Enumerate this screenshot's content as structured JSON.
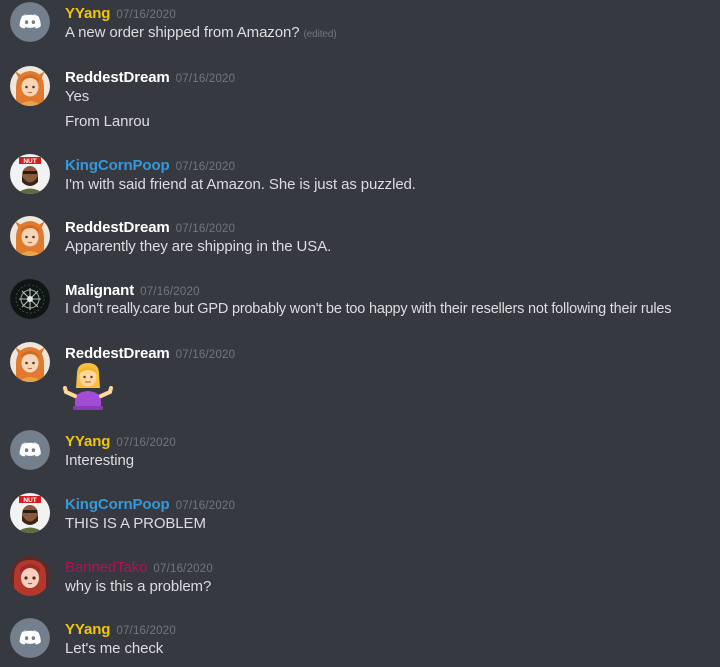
{
  "colors": {
    "background": "#36393f",
    "message_text": "#dcddde",
    "timestamp": "#72767d",
    "role_gold": "#f1c40f",
    "role_blue": "#3498db",
    "role_white": "#ffffff",
    "role_red": "#ad1457"
  },
  "messages": [
    {
      "username": "YYang",
      "timestamp": "07/16/2020",
      "avatar_icon": "discord-default-avatar-icon",
      "lines": [
        "A new order shipped from Amazon?"
      ],
      "edited_label": "(edited)"
    },
    {
      "username": "ReddestDream",
      "timestamp": "07/16/2020",
      "avatar_icon": "anime-girl-avatar-icon",
      "lines": [
        "Yes",
        "From Lanrou"
      ]
    },
    {
      "username": "KingCornPoop",
      "timestamp": "07/16/2020",
      "avatar_icon": "nut-bearded-man-avatar-icon",
      "lines": [
        "I'm with said friend at Amazon.  She is just as puzzled."
      ]
    },
    {
      "username": "ReddestDream",
      "timestamp": "07/16/2020",
      "avatar_icon": "anime-girl-avatar-icon",
      "lines": [
        "Apparently they are shipping in the USA."
      ]
    },
    {
      "username": "Malignant",
      "timestamp": "07/16/2020",
      "avatar_icon": "dark-emblem-avatar-icon",
      "lines": [
        "I don't really.care but GPD probably won't be too happy with their resellers not following their rules"
      ]
    },
    {
      "username": "ReddestDream",
      "timestamp": "07/16/2020",
      "avatar_icon": "anime-girl-avatar-icon",
      "lines": [],
      "emoji": "woman-shrugging-emoji-icon"
    },
    {
      "username": "YYang",
      "timestamp": "07/16/2020",
      "avatar_icon": "discord-default-avatar-icon",
      "lines": [
        "Interesting"
      ]
    },
    {
      "username": "KingCornPoop",
      "timestamp": "07/16/2020",
      "avatar_icon": "nut-bearded-man-avatar-icon",
      "lines": [
        "THIS IS A PROBLEM"
      ]
    },
    {
      "username": "BannedTako",
      "timestamp": "07/16/2020",
      "avatar_icon": "red-hair-girl-avatar-icon",
      "lines": [
        "why is this a problem?"
      ]
    },
    {
      "username": "YYang",
      "timestamp": "07/16/2020",
      "avatar_icon": "discord-default-avatar-icon",
      "lines": [
        "Let's me check"
      ]
    }
  ],
  "nut_badge_text": "NUT"
}
